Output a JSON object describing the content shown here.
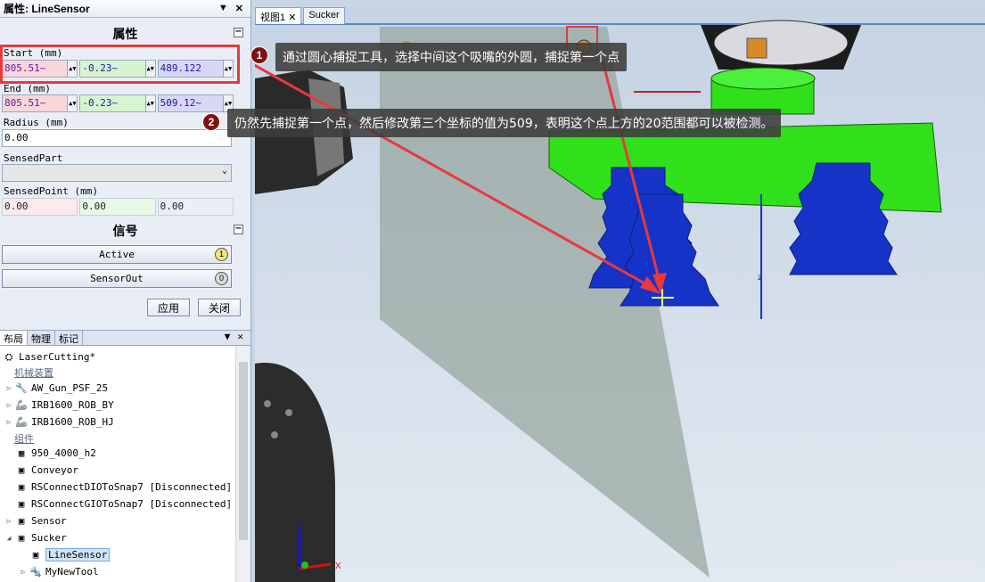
{
  "properties_panel": {
    "title": "属性: LineSensor",
    "section_props": "属性",
    "start_label": "Start (mm)",
    "start_values": [
      "805.51~",
      "-0.23~",
      "489.122"
    ],
    "end_label": "End (mm)",
    "end_values": [
      "805.51~",
      "-0.23~",
      "509.12~"
    ],
    "radius_label": "Radius (mm)",
    "radius_value": "0.00",
    "sensed_part_label": "SensedPart",
    "sensed_point_label": "SensedPoint (mm)",
    "sensed_point_values": [
      "0.00",
      "0.00",
      "0.00"
    ],
    "section_signals": "信号",
    "signal_active": "Active",
    "signal_active_state": "1",
    "signal_sensorout": "SensorOut",
    "signal_sensorout_state": "0",
    "apply_label": "应用",
    "close_label": "关闭"
  },
  "layout_panel": {
    "tabs": [
      "布局",
      "物理",
      "标记"
    ],
    "station": "LaserCutting*",
    "group_mech": "机械装置",
    "mech_items": [
      "AW_Gun_PSF_25",
      "IRB1600_ROB_BY",
      "IRB1600_ROB_HJ"
    ],
    "group_parts": "组件",
    "part_items": [
      "950_4000_h2",
      "Conveyor",
      "RSConnectDIOToSnap7 [Disconnected]",
      "RSConnectGIOToSnap7 [Disconnected]",
      "Sensor",
      "Sucker",
      "LineSensor",
      "MyNewTool"
    ]
  },
  "viewport": {
    "tabs": [
      "视图1",
      "Sucker"
    ],
    "axis_z": "Z",
    "axis_x": "X"
  },
  "annotations": [
    {
      "number": "1",
      "text": "通过圆心捕捉工具，选择中间这个吸嘴的外圆，捕捉第一个点"
    },
    {
      "number": "2",
      "text": "仍然先捕捉第一个点，然后修改第三个坐标的值为509，表明这个点上方的20范围都可以被检测。"
    }
  ],
  "watermark": "CSDN @巨巨",
  "colors": {
    "highlight_red": "#e8393e",
    "suction_blue": "#1633c8",
    "gripper_green": "#2fe01a"
  }
}
